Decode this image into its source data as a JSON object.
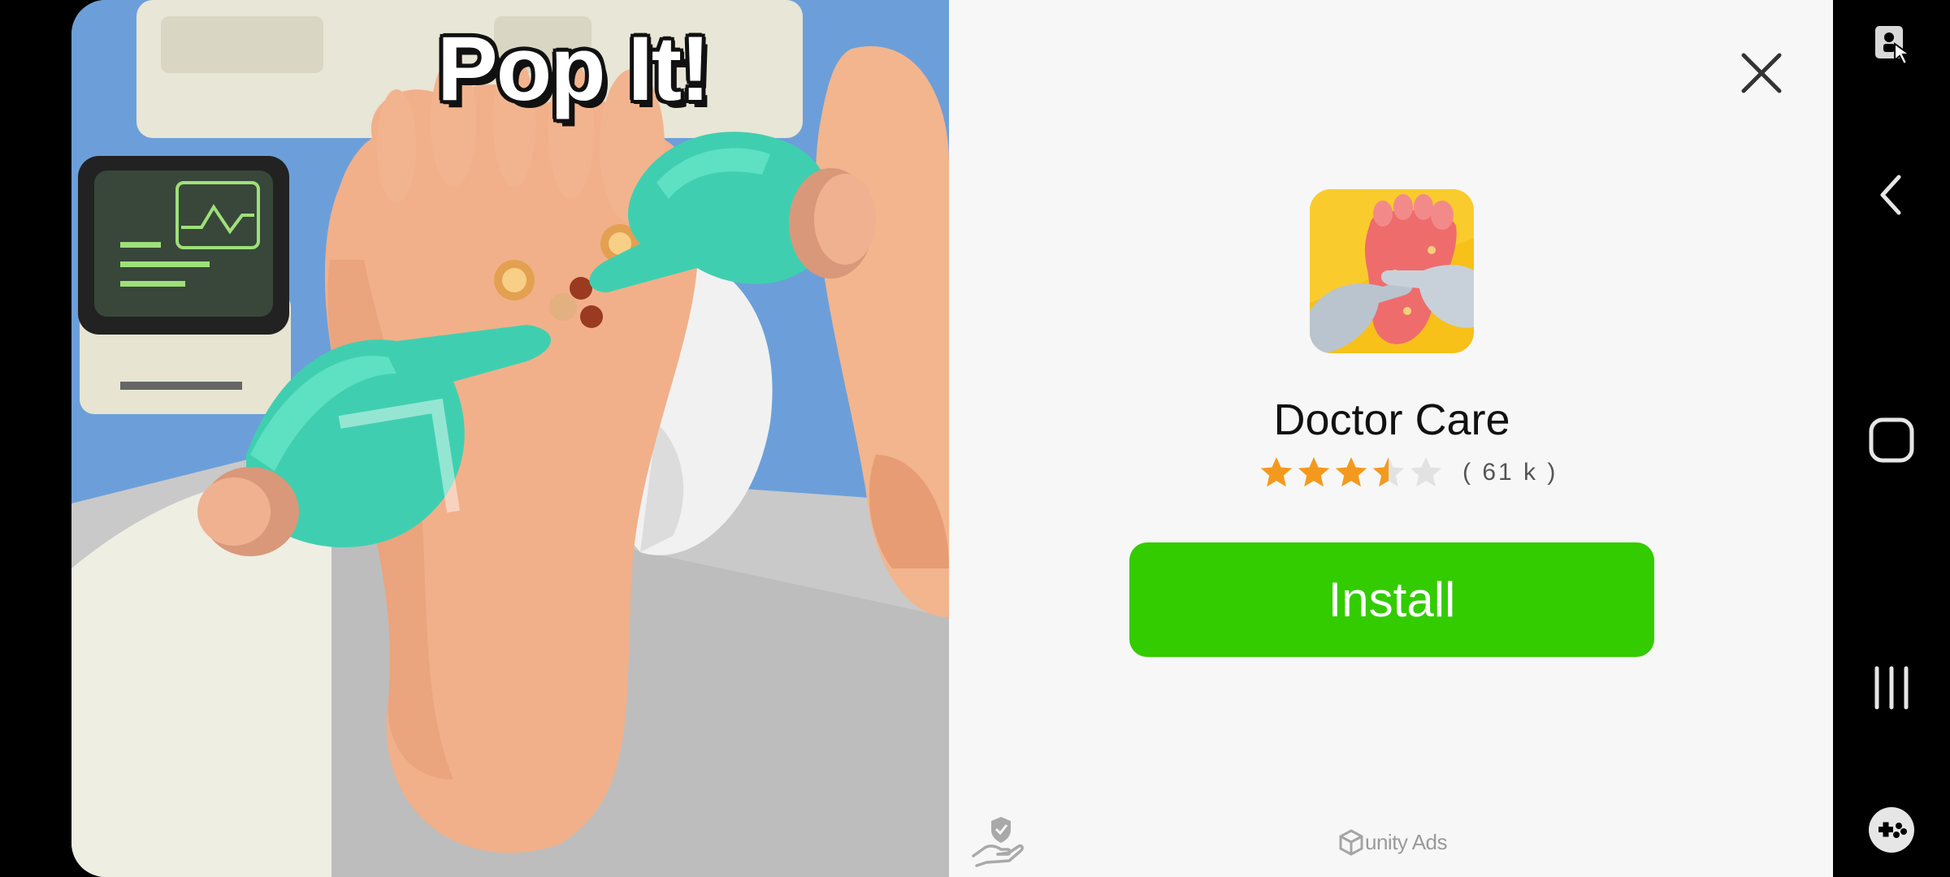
{
  "preview": {
    "title": "Pop It!"
  },
  "ad": {
    "app_name": "Doctor Care",
    "rating": 3.5,
    "rating_max": 5,
    "rating_count": "( 61 k )",
    "install_label": "Install",
    "sponsor": "unity Ads",
    "accent_color": "#33cc00",
    "star_color": "#f39a1e"
  },
  "icons": {
    "close": "close-icon",
    "privacy": "privacy-shield-icon",
    "nav": [
      "accessibility-icon",
      "back-icon",
      "home-icon",
      "recents-icon",
      "game-tools-icon"
    ]
  }
}
